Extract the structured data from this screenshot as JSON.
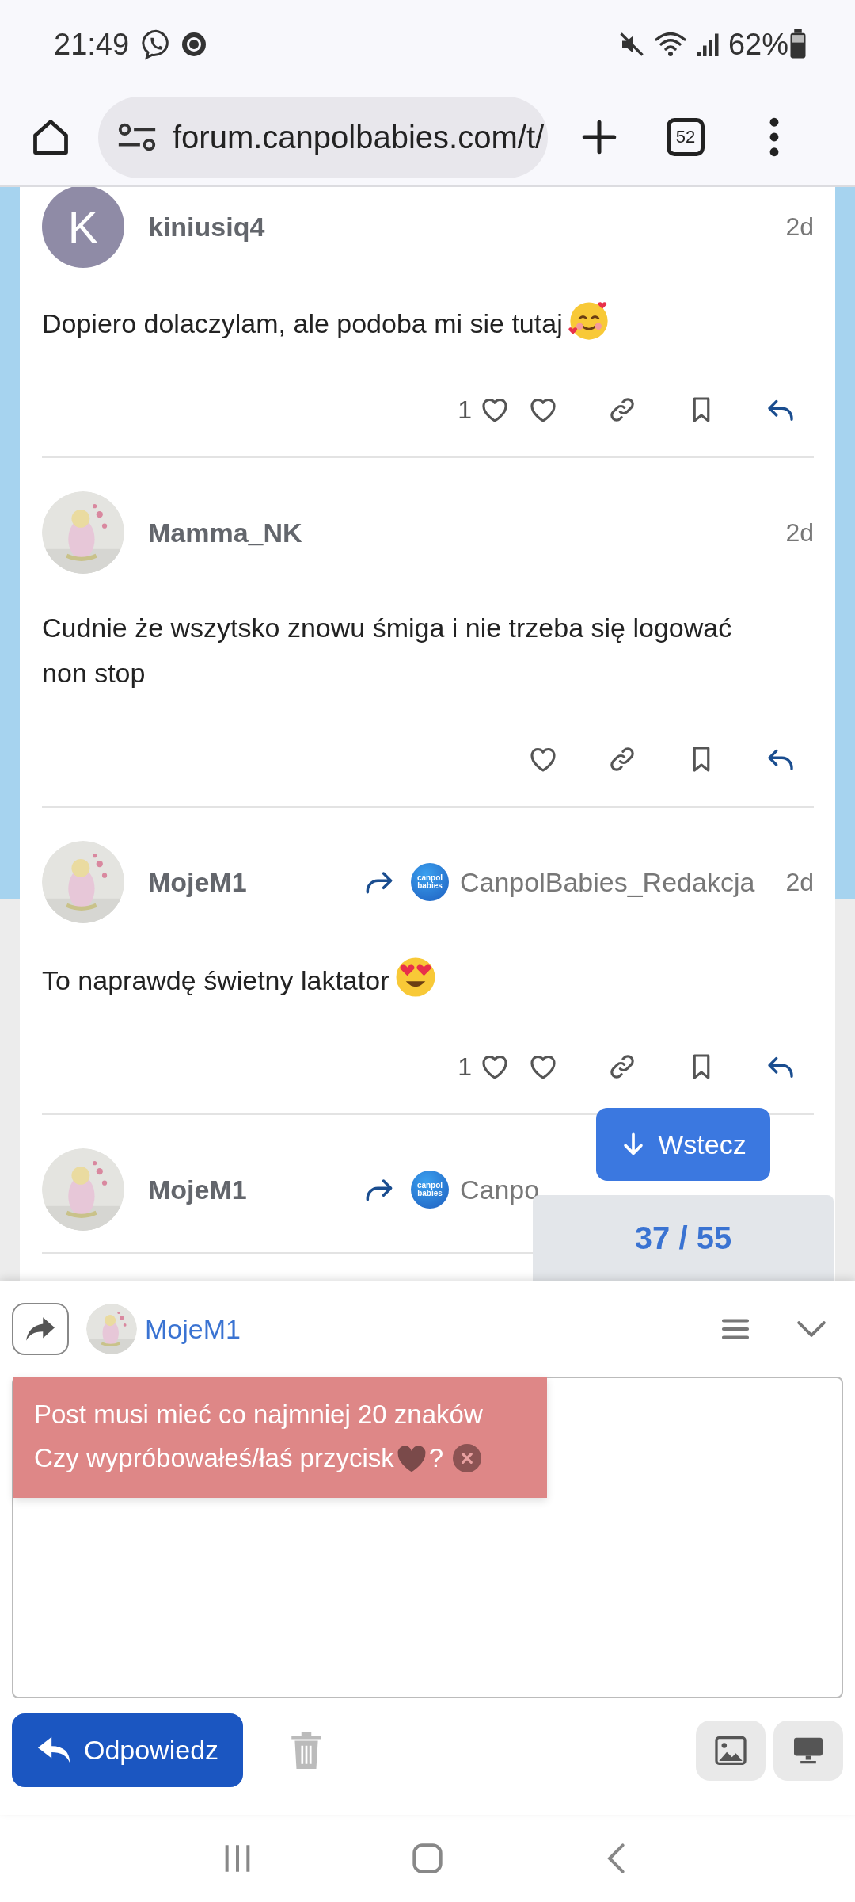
{
  "status_bar": {
    "time": "21:49",
    "battery": "62%"
  },
  "browser": {
    "url": "forum.canpolbabies.com/t/",
    "tab_count": "52"
  },
  "posts": [
    {
      "author": "kiniusiq4",
      "avatar": {
        "kind": "letter",
        "letter": "K",
        "color": "#8f8ba6"
      },
      "time": "2d",
      "text": "Dopiero dolaczylam, ale podoba mi sie tutaj",
      "emoji": {
        "kind": "smiling-hearts"
      },
      "reaction_count": "1"
    },
    {
      "author": "Mamma_NK",
      "time": "2d",
      "text": "Cudnie że wszytsko znowu śmiga i nie trzeba się logować non stop"
    },
    {
      "author": "MojeM1",
      "reply_to": {
        "name": "CanpolBabies_Redakcja",
        "logo": "canpol babies"
      },
      "time": "2d",
      "text": "To naprawdę świetny laktator",
      "emoji": {
        "kind": "heart-eyes"
      },
      "reaction_count": "1"
    },
    {
      "author": "MojeM1",
      "reply_to": {
        "name": "Canpo",
        "logo": "canpol babies"
      }
    }
  ],
  "jump_button": {
    "label": "Wstecz"
  },
  "progress": "37 / 55",
  "composer": {
    "author": "MojeM1",
    "error": {
      "line1": "Post musi mieć co najmniej 20 znaków",
      "line2": "Czy wypróbowałeś/łaś przycisk",
      "line2_end": "?"
    },
    "submit": "Odpowiedz"
  }
}
